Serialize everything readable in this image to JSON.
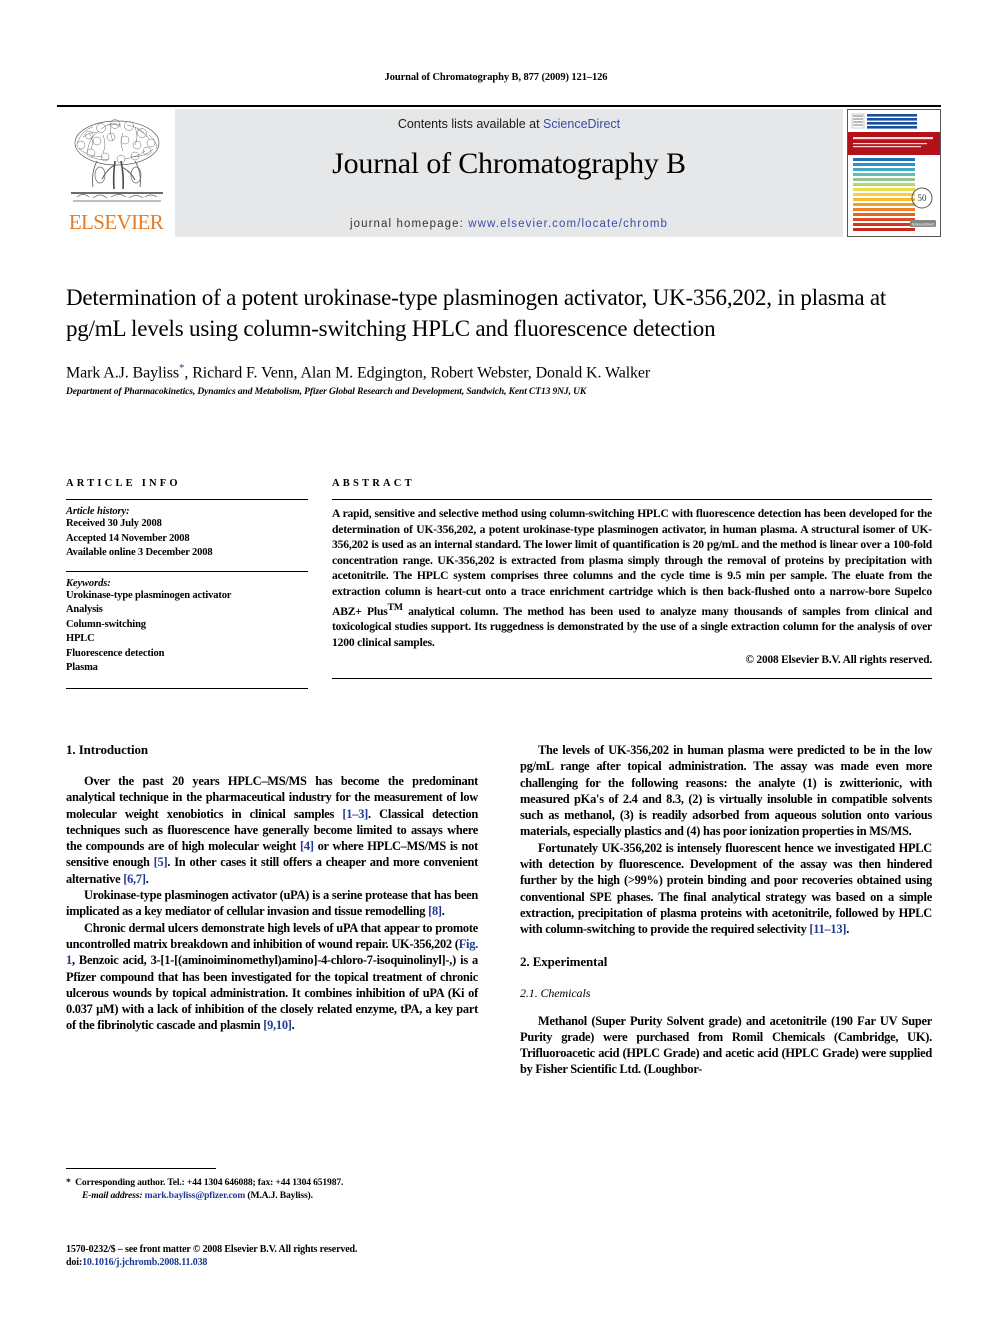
{
  "running_head": "Journal of Chromatography B, 877 (2009) 121–126",
  "masthead": {
    "contents_prefix": "Contents lists available at ",
    "sciencedirect": "ScienceDirect",
    "journal_title": "Journal of Chromatography B",
    "homepage_prefix": "journal homepage: ",
    "homepage_url": "www.elsevier.com/locate/chromb",
    "publisher": "ELSEVIER",
    "cover_banner": "JOURNAL OF CHROMATOGRAPHY B",
    "cover_subline": "ANALYTICAL TECHNOLOGIES IN THE BIOMEDICAL AND LIFE SCIENCES",
    "cover_badge": "50",
    "cover_badge_sub": "YEARS",
    "cover_sciencedirect": "ScienceDirect",
    "link_color": "#3B4CA8",
    "elsevier_orange": "#E87B22",
    "band_color": "#E6E7E8"
  },
  "article": {
    "title": "Determination of a potent urokinase-type plasminogen activator, UK-356,202, in plasma at pg/mL levels using column-switching HPLC and fluorescence detection",
    "authors_pre": "Mark A.J. Bayliss",
    "author_star": "*",
    "authors_post": ", Richard F. Venn, Alan M. Edgington, Robert Webster, Donald K. Walker",
    "affiliation": "Department of Pharmacokinetics, Dynamics and Metabolism, Pfizer Global Research and Development, Sandwich, Kent CT13 9NJ, UK"
  },
  "info": {
    "heading": "ARTICLE INFO",
    "history_label": "Article history:",
    "history": [
      "Received 30 July 2008",
      "Accepted 14 November 2008",
      "Available online 3 December 2008"
    ],
    "keywords_label": "Keywords:",
    "keywords": [
      "Urokinase-type plasminogen activator",
      "Analysis",
      "Column-switching",
      "HPLC",
      "Fluorescence detection",
      "Plasma"
    ]
  },
  "abstract": {
    "heading": "ABSTRACT",
    "body_1": "A rapid, sensitive and selective method using column-switching HPLC with fluorescence detection has been developed for the determination of UK-356,202, a potent urokinase-type plasminogen activator, in human plasma. A structural isomer of UK-356,202 is used as an internal standard. The lower limit of quantification is 20 pg/mL and the method is linear over a 100-fold concentration range. UK-356,202 is extracted from plasma simply through the removal of proteins by precipitation with acetonitrile. The HPLC system comprises three columns and the cycle time is 9.5 min per sample. The eluate from the extraction column is heart-cut onto a trace enrichment cartridge which is then back-flushed onto a narrow-bore Supelco ABZ+ Plus",
    "trademark": "TM",
    "body_2": " analytical column. The method has been used to analyze many thousands of samples from clinical and toxicological studies support. Its ruggedness is demonstrated by the use of a single extraction column for the analysis of over 1200 clinical samples.",
    "copyright": "© 2008 Elsevier B.V. All rights reserved."
  },
  "sections": {
    "introduction_heading": "1. Introduction",
    "experimental_heading": "2. Experimental",
    "chemicals_heading": "2.1. Chemicals"
  },
  "left_column": {
    "p1_a": "Over the past 20 years HPLC–MS/MS has become the predominant analytical technique in the pharmaceutical industry for the measurement of low molecular weight xenobiotics in clinical samples ",
    "p1_cite1": "[1–3]",
    "p1_b": ". Classical detection techniques such as fluorescence have generally become limited to assays where the compounds are of high molecular weight ",
    "p1_cite2": "[4]",
    "p1_c": " or where HPLC–MS/MS is not sensitive enough ",
    "p1_cite3": "[5]",
    "p1_d": ". In other cases it still offers a cheaper and more convenient alternative ",
    "p1_cite4": "[6,7]",
    "p1_e": ".",
    "p2_a": "Urokinase-type plasminogen activator (uPA) is a serine protease that has been implicated as a key mediator of cellular invasion and tissue remodelling ",
    "p2_cite1": "[8]",
    "p2_b": ".",
    "p3_a": "Chronic dermal ulcers demonstrate high levels of uPA that appear to promote uncontrolled matrix breakdown and inhibition of wound repair. UK-356,202 (",
    "p3_cite1": "Fig. 1",
    "p3_b": ", Benzoic acid, 3-[1-[(aminoiminomethyl)amino]-4-chloro-7-isoquinolinyl]-,) is a Pfizer compound that has been investigated for the topical treatment of chronic ulcerous wounds by topical administration. It combines inhibition of uPA (Ki of 0.037 μM) with a lack of inhibition of the closely related enzyme, tPA, a key part of the fibrinolytic cascade and plasmin ",
    "p3_cite2": "[9,10]",
    "p3_c": "."
  },
  "right_column": {
    "p1": "The levels of UK-356,202 in human plasma were predicted to be in the low pg/mL range after topical administration. The assay was made even more challenging for the following reasons: the analyte (1) is zwitterionic, with measured pKa's of 2.4 and 8.3, (2) is virtually insoluble in compatible solvents such as methanol, (3) is readily adsorbed from aqueous solution onto various materials, especially plastics and (4) has poor ionization properties in MS/MS.",
    "p2_a": "Fortunately UK-356,202 is intensely fluorescent hence we investigated HPLC with detection by fluorescence. Development of the assay was then hindered further by the high (>99%) protein binding and poor recoveries obtained using conventional SPE phases. The final analytical strategy was based on a simple extraction, precipitation of plasma proteins with acetonitrile, followed by HPLC with column-switching to provide the required selectivity ",
    "p2_cite1": "[11–13]",
    "p2_b": ".",
    "p3": "Methanol (Super Purity Solvent grade) and acetonitrile (190 Far UV Super Purity grade) were purchased from Romil Chemicals (Cambridge, UK). Trifluoroacetic acid (HPLC Grade) and acetic acid (HPLC Grade) were supplied by Fisher Scientific Ltd. (Loughbor-"
  },
  "footnotes": {
    "corresponding_star": "*",
    "corresponding": "Corresponding author. Tel.: +44 1304 646088; fax: +44 1304 651987.",
    "email_label": "E-mail address:",
    "email": "mark.bayliss@pfizer.com",
    "email_suffix": "(M.A.J. Bayliss).",
    "frontmatter": "1570-0232/$ – see front matter © 2008 Elsevier B.V. All rights reserved.",
    "doi_label": "doi:",
    "doi": "10.1016/j.jchromb.2008.11.038"
  }
}
